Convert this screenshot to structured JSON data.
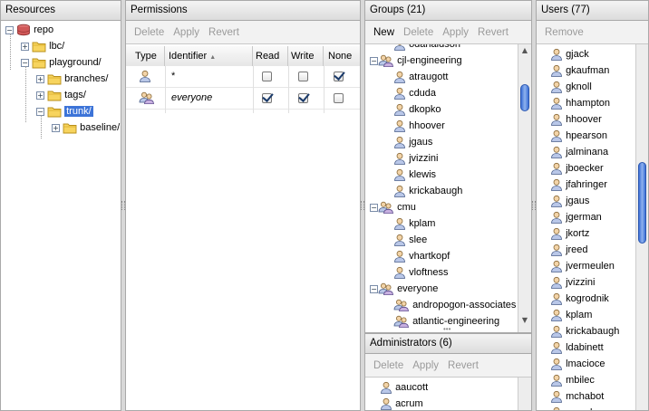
{
  "resources": {
    "title": "Resources",
    "tree": [
      {
        "label": "repo",
        "kind": "repo",
        "expand": "−",
        "level": 0
      },
      {
        "label": "lbc/",
        "kind": "folder",
        "expand": "+",
        "level": 1
      },
      {
        "label": "playground/",
        "kind": "folder",
        "expand": "−",
        "level": 1
      },
      {
        "label": "branches/",
        "kind": "folder",
        "expand": "+",
        "level": 2
      },
      {
        "label": "tags/",
        "kind": "folder",
        "expand": "+",
        "level": 2
      },
      {
        "label": "trunk/",
        "kind": "folder",
        "expand": "−",
        "level": 2,
        "selected": true
      },
      {
        "label": "baseline/",
        "kind": "folder",
        "expand": "+",
        "level": 3
      }
    ]
  },
  "permissions": {
    "title": "Permissions",
    "toolbar": [
      "Delete",
      "Apply",
      "Revert"
    ],
    "columns": [
      "Type",
      "Identifier",
      "Read",
      "Write",
      "None"
    ],
    "rows": [
      {
        "type": "user",
        "identifier": "*",
        "read": false,
        "write": false,
        "none": true
      },
      {
        "type": "group",
        "identifier": "everyone",
        "read": true,
        "write": true,
        "none": false
      }
    ]
  },
  "groups": {
    "title": "Groups (21)",
    "toolbar": [
      "New",
      "Delete",
      "Apply",
      "Revert"
    ],
    "items": [
      {
        "label": "odanaidson",
        "kind": "user",
        "level": 1,
        "expand": ""
      },
      {
        "label": "cjl-engineering",
        "kind": "group",
        "level": 0,
        "expand": "−"
      },
      {
        "label": "atraugott",
        "kind": "user",
        "level": 1,
        "expand": ""
      },
      {
        "label": "cduda",
        "kind": "user",
        "level": 1,
        "expand": ""
      },
      {
        "label": "dkopko",
        "kind": "user",
        "level": 1,
        "expand": ""
      },
      {
        "label": "hhoover",
        "kind": "user",
        "level": 1,
        "expand": ""
      },
      {
        "label": "jgaus",
        "kind": "user",
        "level": 1,
        "expand": ""
      },
      {
        "label": "jvizzini",
        "kind": "user",
        "level": 1,
        "expand": ""
      },
      {
        "label": "klewis",
        "kind": "user",
        "level": 1,
        "expand": ""
      },
      {
        "label": "krickabaugh",
        "kind": "user",
        "level": 1,
        "expand": ""
      },
      {
        "label": "cmu",
        "kind": "group",
        "level": 0,
        "expand": "−"
      },
      {
        "label": "kplam",
        "kind": "user",
        "level": 1,
        "expand": ""
      },
      {
        "label": "slee",
        "kind": "user",
        "level": 1,
        "expand": ""
      },
      {
        "label": "vhartkopf",
        "kind": "user",
        "level": 1,
        "expand": ""
      },
      {
        "label": "vloftness",
        "kind": "user",
        "level": 1,
        "expand": ""
      },
      {
        "label": "everyone",
        "kind": "group",
        "level": 0,
        "expand": "−"
      },
      {
        "label": "andropogon-associates",
        "kind": "group",
        "level": 1,
        "expand": ""
      },
      {
        "label": "atlantic-engineering",
        "kind": "group",
        "level": 1,
        "expand": ""
      }
    ]
  },
  "administrators": {
    "title": "Administrators (6)",
    "toolbar": [
      "Delete",
      "Apply",
      "Revert"
    ],
    "items": [
      "aaucott",
      "acrum"
    ]
  },
  "users": {
    "title": "Users (77)",
    "toolbar": [
      "Remove"
    ],
    "items": [
      "gjack",
      "gkaufman",
      "gknoll",
      "hhampton",
      "hhoover",
      "hpearson",
      "jalminana",
      "jboecker",
      "jfahringer",
      "jgaus",
      "jgerman",
      "jkortz",
      "jreed",
      "jvermeulen",
      "jvizzini",
      "kogrodnik",
      "kplam",
      "krickabaugh",
      "ldabinett",
      "lmacioce",
      "mbilec",
      "mchabot",
      "mcoulson"
    ]
  }
}
